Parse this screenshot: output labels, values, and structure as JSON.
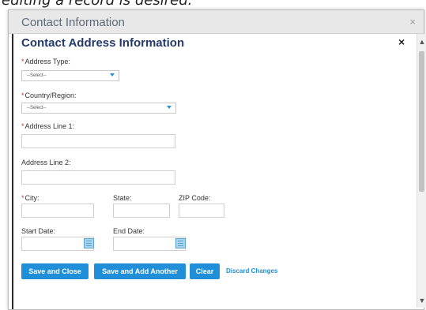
{
  "background_caption": "editing a record is desired.",
  "outer_dialog": {
    "title": "Contact Information",
    "close": "×"
  },
  "dialog": {
    "title": "Contact Address Information",
    "close": "×",
    "required_marker": "*"
  },
  "fields": {
    "address_type": {
      "label": "Address Type:",
      "required": true,
      "value": "--Select--"
    },
    "country_region": {
      "label": "Country/Region:",
      "required": true,
      "value": "--Select--"
    },
    "address_line_1": {
      "label": "Address Line 1:",
      "required": true,
      "value": ""
    },
    "address_line_2": {
      "label": "Address Line 2:",
      "required": false,
      "value": ""
    },
    "city": {
      "label": "City:",
      "required": true,
      "value": ""
    },
    "state": {
      "label": "State:",
      "required": false,
      "value": ""
    },
    "zip_code": {
      "label": "ZIP Code:",
      "required": false,
      "value": ""
    },
    "start_date": {
      "label": "Start Date:",
      "required": false,
      "value": ""
    },
    "end_date": {
      "label": "End Date:",
      "required": false,
      "value": ""
    }
  },
  "buttons": {
    "save_close": "Save and Close",
    "save_add_another": "Save and Add Another",
    "clear": "Clear",
    "discard": "Discard Changes"
  },
  "scrollbar": {
    "up": "▲",
    "down": "▼"
  },
  "icons": {
    "calendar": "calendar-icon",
    "dropdown": "chevron-down-icon"
  },
  "colors": {
    "accent": "#1e8fd8",
    "title": "#243a6b",
    "required": "#c0392b"
  }
}
